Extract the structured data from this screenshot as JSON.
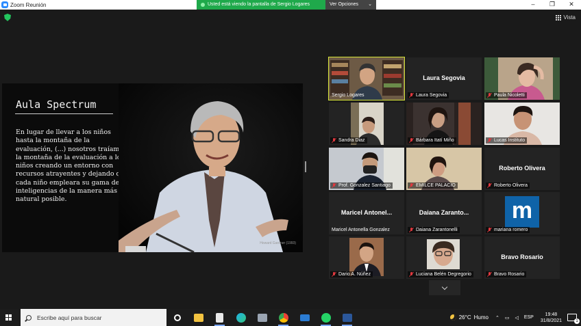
{
  "window": {
    "title": "Zoom Reunión",
    "controls": {
      "minimize": "–",
      "maximize": "❐",
      "close": "✕"
    }
  },
  "share_banner": {
    "message": "Usted está viendo la pantalla de Sergio Logares",
    "options_label": "Ver Opciones",
    "options_chevron": "⌄"
  },
  "view": {
    "label": "Vista"
  },
  "slide": {
    "title": "Aula Spectrum",
    "body": "En lugar de llevar a los niños\nhasta la montaña de la\nevaluación, (...) nosotros traíamos\nla montaña de la evaluación a los\nniños creando un entorno con\nrecursos atrayentes y dejando que\ncada niño empleara su gama de\ninteligencias de la manera más\nnatural posible.",
    "credit": "Howard Gardner (1993)"
  },
  "participants": [
    {
      "label": "Sergio Logares",
      "muted": false,
      "big_name": "",
      "active": true,
      "video": "man-glasses-bookshelf"
    },
    {
      "label": "Laura Segovia",
      "muted": true,
      "big_name": "Laura Segovia",
      "active": false,
      "video": ""
    },
    {
      "label": "Paula Nicoletti",
      "muted": true,
      "big_name": "",
      "active": false,
      "video": "woman-hand-head"
    },
    {
      "label": "Sandra Diaz",
      "muted": true,
      "big_name": "",
      "active": false,
      "video": "woman-curtain"
    },
    {
      "label": "Bárbara Itatí Miño",
      "muted": true,
      "big_name": "",
      "active": false,
      "video": "woman-glasses-room"
    },
    {
      "label": "Lucas Instituto",
      "muted": true,
      "big_name": "",
      "active": false,
      "video": "young-man"
    },
    {
      "label": "Prof. Gonzalez Santiago",
      "muted": true,
      "big_name": "",
      "active": false,
      "video": "man-mask"
    },
    {
      "label": "EMILCE PALACIO",
      "muted": true,
      "big_name": "",
      "active": false,
      "video": "woman-wall"
    },
    {
      "label": "Roberto Olivera",
      "muted": true,
      "big_name": "Roberto Olivera",
      "active": false,
      "video": ""
    },
    {
      "label": "Maricel Antonella Gonzalez",
      "muted": false,
      "big_name": "Maricel Antonel...",
      "active": false,
      "video": ""
    },
    {
      "label": "Daiana Zarantonelli",
      "muted": true,
      "big_name": "Daiana Zaranto...",
      "active": false,
      "video": ""
    },
    {
      "label": "mariana romero",
      "muted": true,
      "big_name": "",
      "active": false,
      "video": "m-logo",
      "avatar_letter": "m"
    },
    {
      "label": "Dario A. Núñez",
      "muted": true,
      "big_name": "",
      "active": false,
      "video": "man-suit"
    },
    {
      "label": "Luciana Belén Degregorio",
      "muted": true,
      "big_name": "",
      "active": false,
      "video": "woman-glasses"
    },
    {
      "label": "Bravo Rosario",
      "muted": true,
      "big_name": "Bravo Rosario",
      "active": false,
      "video": ""
    }
  ],
  "taskbar": {
    "search_placeholder": "Escribe aquí para buscar",
    "apps": [
      "task-view",
      "file-explorer",
      "notepad",
      "edge",
      "camera",
      "chrome",
      "mail",
      "whatsapp",
      "word"
    ],
    "weather": {
      "temp": "26°C",
      "condition": "Humo"
    },
    "lang": "ESP",
    "time": "19:48",
    "date": "31/8/2021",
    "colors": {
      "accent": "#2d8cff",
      "share_green": "#1fa94b",
      "active_speaker": "#d6e53a"
    }
  }
}
